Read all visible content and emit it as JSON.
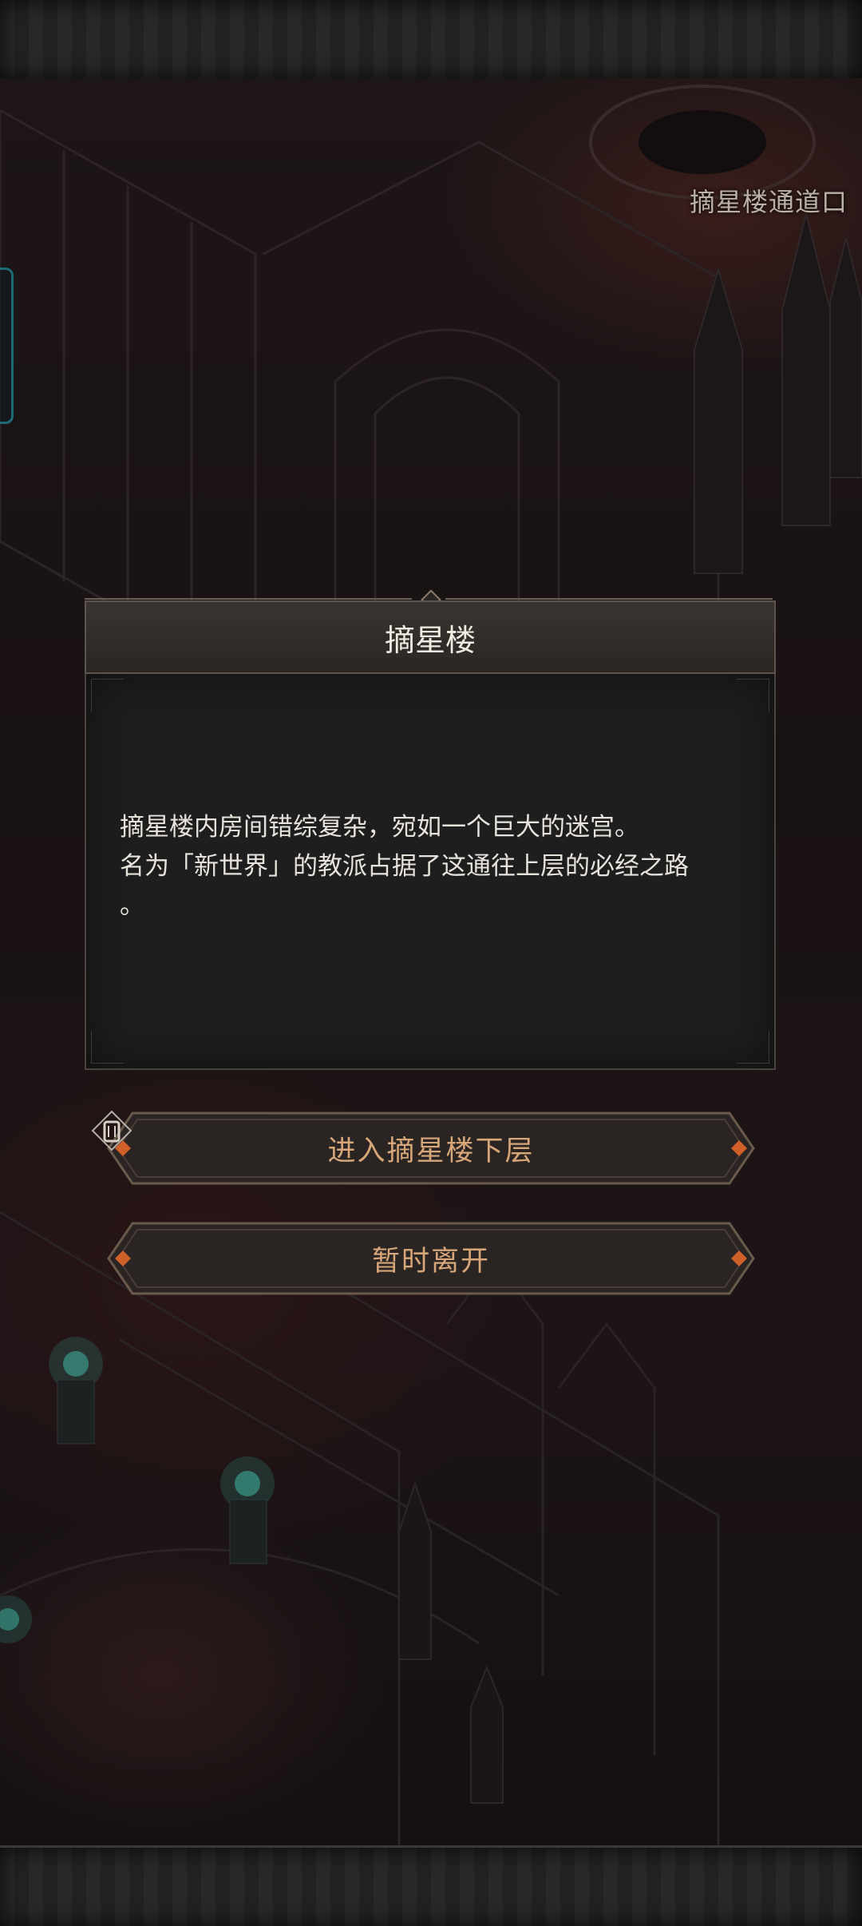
{
  "location": {
    "label": "摘星楼通道口"
  },
  "dialog": {
    "title": "摘星楼",
    "description": [
      "摘星楼内房间错综复杂，宛如一个巨大的迷宫。",
      "名为「新世界」的教派占据了这通往上层的必经之路",
      "。"
    ]
  },
  "actions": {
    "enter_label": "进入摘星楼下层",
    "leave_label": "暂时离开"
  },
  "colors": {
    "button_text": "#d7a77a",
    "accent_gem": "#d0602a",
    "teal_glow": "#3fb7a4"
  }
}
